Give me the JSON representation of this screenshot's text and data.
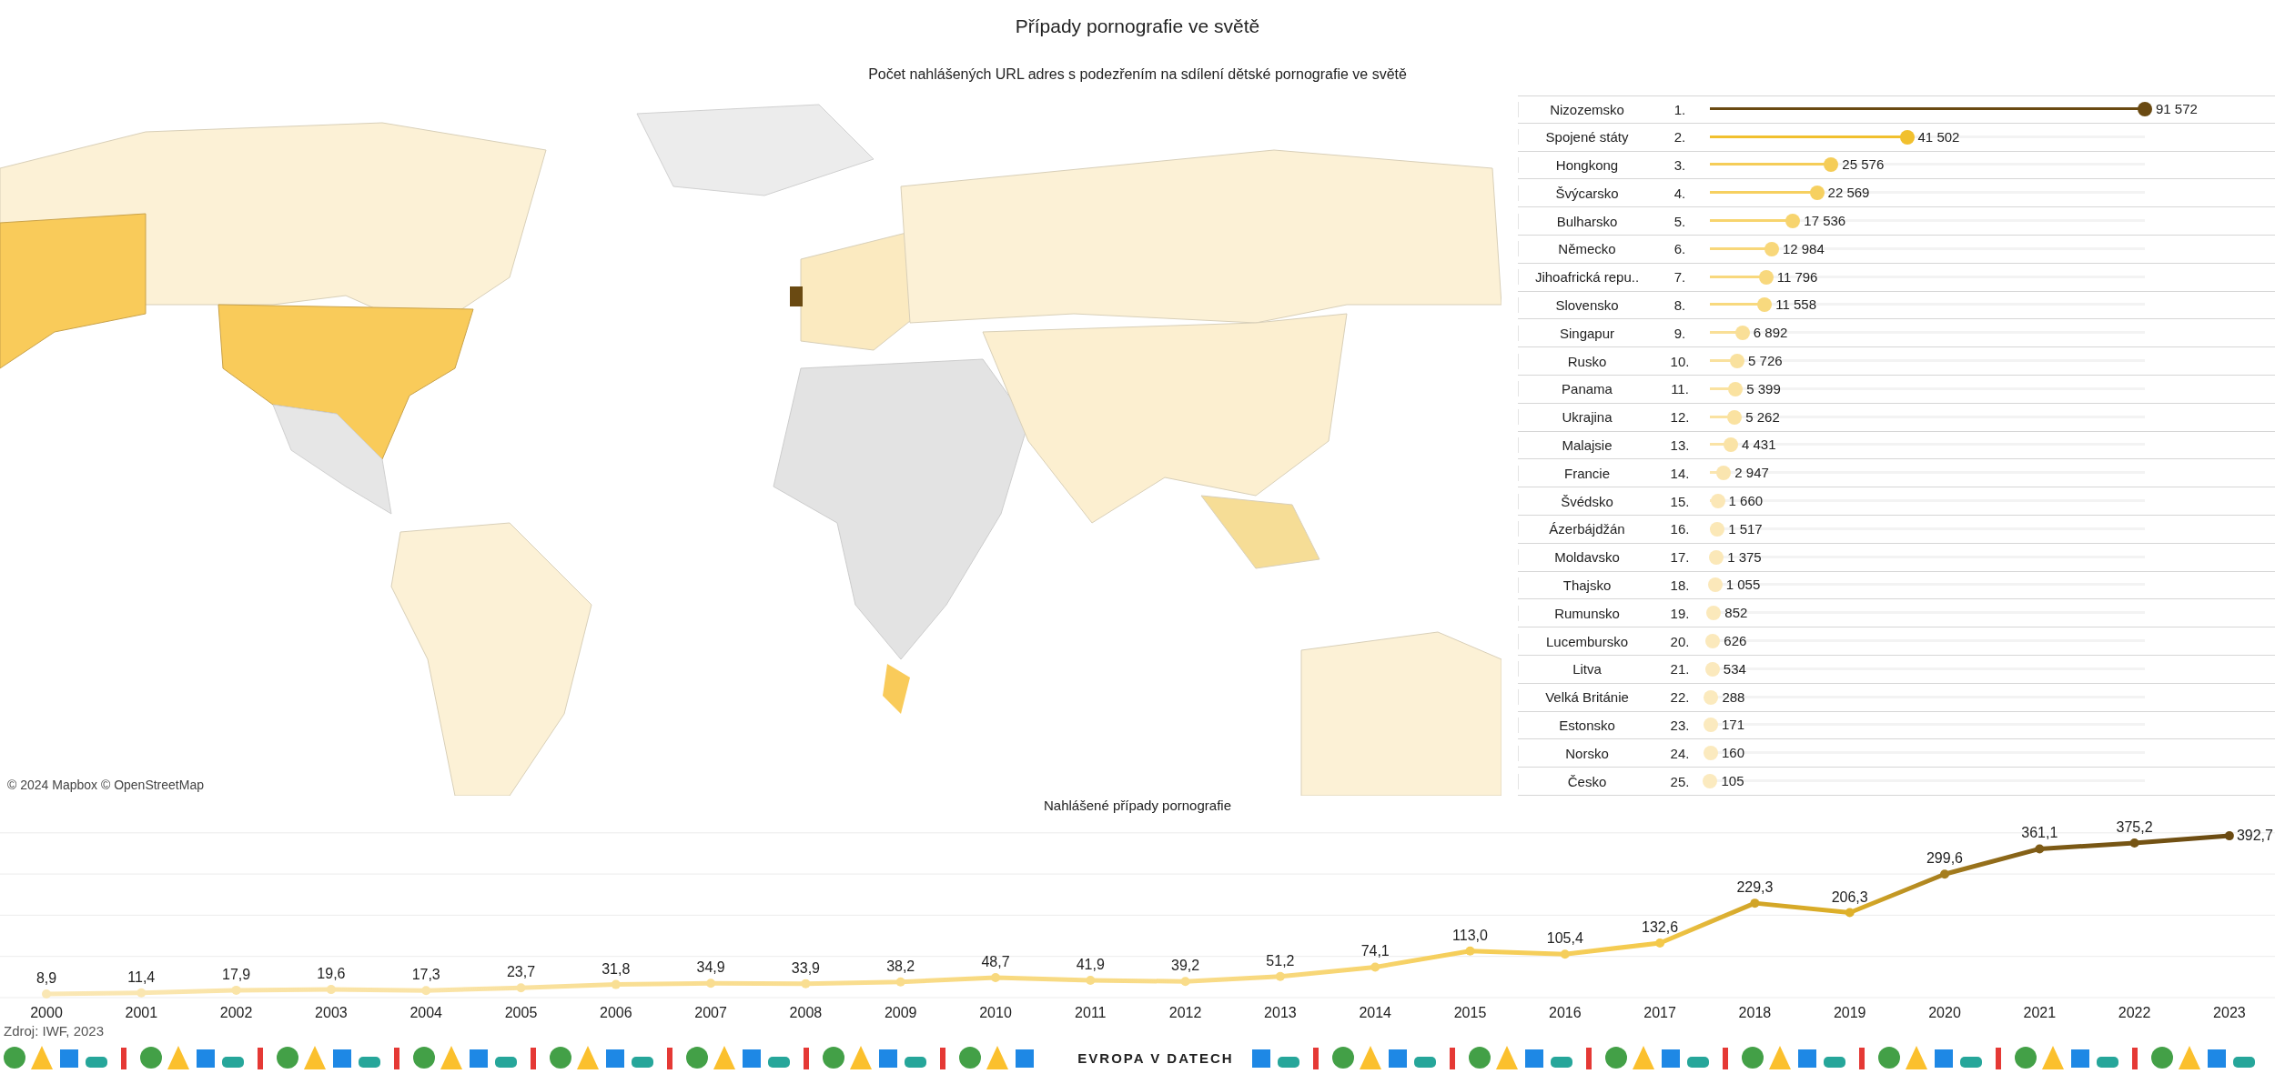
{
  "title": "Případy pornografie ve světě",
  "map": {
    "subtitle": "Počet nahlášených URL adres s podezřením na sdílení dětské pornografie ve světě",
    "attribution": "© 2024 Mapbox © OpenStreetMap"
  },
  "ranking": [
    {
      "country": "Nizozemsko",
      "rank": "1.",
      "value": "91 572",
      "level": 1
    },
    {
      "country": "Spojené státy",
      "rank": "2.",
      "value": "41 502",
      "level": 0.453
    },
    {
      "country": "Hongkong",
      "rank": "3.",
      "value": "25 576",
      "level": 0.279
    },
    {
      "country": "Švýcarsko",
      "rank": "4.",
      "value": "22 569",
      "level": 0.246
    },
    {
      "country": "Bulharsko",
      "rank": "5.",
      "value": "17 536",
      "level": 0.191
    },
    {
      "country": "Německo",
      "rank": "6.",
      "value": "12 984",
      "level": 0.142
    },
    {
      "country": "Jihoafrická repu..",
      "rank": "7.",
      "value": "11 796",
      "level": 0.129
    },
    {
      "country": "Slovensko",
      "rank": "8.",
      "value": "11 558",
      "level": 0.126
    },
    {
      "country": "Singapur",
      "rank": "9.",
      "value": "6 892",
      "level": 0.075
    },
    {
      "country": "Rusko",
      "rank": "10.",
      "value": "5 726",
      "level": 0.063
    },
    {
      "country": "Panama",
      "rank": "11.",
      "value": "5 399",
      "level": 0.059
    },
    {
      "country": "Ukrajina",
      "rank": "12.",
      "value": "5 262",
      "level": 0.057
    },
    {
      "country": "Malajsie",
      "rank": "13.",
      "value": "4 431",
      "level": 0.048
    },
    {
      "country": "Francie",
      "rank": "14.",
      "value": "2 947",
      "level": 0.032
    },
    {
      "country": "Švédsko",
      "rank": "15.",
      "value": "1 660",
      "level": 0.018
    },
    {
      "country": "Ázerbájdžán",
      "rank": "16.",
      "value": "1 517",
      "level": 0.017
    },
    {
      "country": "Moldavsko",
      "rank": "17.",
      "value": "1 375",
      "level": 0.015
    },
    {
      "country": "Thajsko",
      "rank": "18.",
      "value": "1 055",
      "level": 0.012
    },
    {
      "country": "Rumunsko",
      "rank": "19.",
      "value": "852",
      "level": 0.009
    },
    {
      "country": "Lucembursko",
      "rank": "20.",
      "value": "626",
      "level": 0.007
    },
    {
      "country": "Litva",
      "rank": "21.",
      "value": "534",
      "level": 0.006
    },
    {
      "country": "Velká Británie",
      "rank": "22.",
      "value": "288",
      "level": 0.003
    },
    {
      "country": "Estonsko",
      "rank": "23.",
      "value": "171",
      "level": 0.002
    },
    {
      "country": "Norsko",
      "rank": "24.",
      "value": "160",
      "level": 0.002
    },
    {
      "country": "Česko",
      "rank": "25.",
      "value": "105",
      "level": 0.001
    }
  ],
  "trend": {
    "chart_data": {
      "type": "line",
      "title": "Nahlášené případy pornografie",
      "categories": [
        "2000",
        "2001",
        "2002",
        "2003",
        "2004",
        "2005",
        "2006",
        "2007",
        "2008",
        "2009",
        "2010",
        "2011",
        "2012",
        "2013",
        "2014",
        "2015",
        "2016",
        "2017",
        "2018",
        "2019",
        "2020",
        "2021",
        "2022",
        "2023"
      ],
      "series": [
        {
          "color": "#f2c12e",
          "marker": "circle",
          "values": [
            8.9,
            11.4,
            17.9,
            19.6,
            17.3,
            23.7,
            31.8,
            34.9,
            33.9,
            38.2,
            48.7,
            41.9,
            39.2,
            51.2,
            74.1,
            113.0,
            105.4,
            132.6,
            229.3,
            206.3,
            299.6,
            361.1,
            375.2,
            392.7
          ],
          "value_labels": [
            "8,9",
            "11,4",
            "17,9",
            "19,6",
            "17,3",
            "23,7",
            "31,8",
            "34,9",
            "33,9",
            "38,2",
            "48,7",
            "41,9",
            "39,2",
            "51,2",
            "74,1",
            "113,0",
            "105,4",
            "132,6",
            "229,3",
            "206,3",
            "299,6",
            "361,1",
            "375,2",
            "392,7"
          ]
        }
      ]
    }
  },
  "source": "Zdroj: IWF, 2023",
  "footer": {
    "logo": "EVROPA V DATECH"
  }
}
